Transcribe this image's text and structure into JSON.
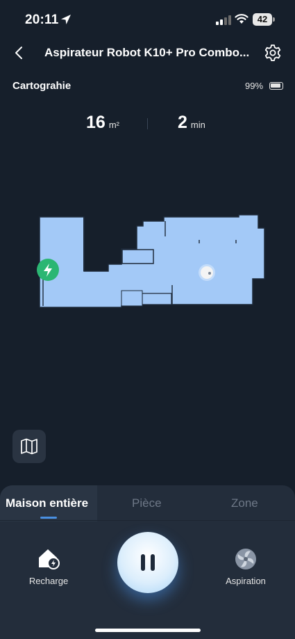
{
  "status_bar": {
    "time": "20:11",
    "battery": "42"
  },
  "header": {
    "title": "Aspirateur Robot K10+ Pro Combo..."
  },
  "subheader": {
    "map_label": "Cartograhie",
    "battery_level": "99%"
  },
  "stats": {
    "area_value": "16",
    "area_unit": "m²",
    "time_value": "2",
    "time_unit": "min"
  },
  "tabs": [
    {
      "label": "Maison entière",
      "active": true
    },
    {
      "label": "Pièce",
      "active": false
    },
    {
      "label": "Zone",
      "active": false
    }
  ],
  "actions": {
    "recharge_label": "Recharge",
    "aspiration_label": "Aspiration"
  },
  "icons": {
    "back": "chevron-left-icon",
    "settings": "gear-icon",
    "map": "map-icon",
    "dock": "charging-dock-icon",
    "robot": "robot-position-icon",
    "recharge": "home-charge-icon",
    "pause": "pause-icon",
    "aspiration": "fan-icon"
  },
  "colors": {
    "background": "#161f2b",
    "map_fill": "#a3c9f7",
    "map_outline": "#1e2a3a",
    "dock": "#2bb673",
    "tab_indicator": "#4a90e2",
    "panel": "#232d3b"
  }
}
